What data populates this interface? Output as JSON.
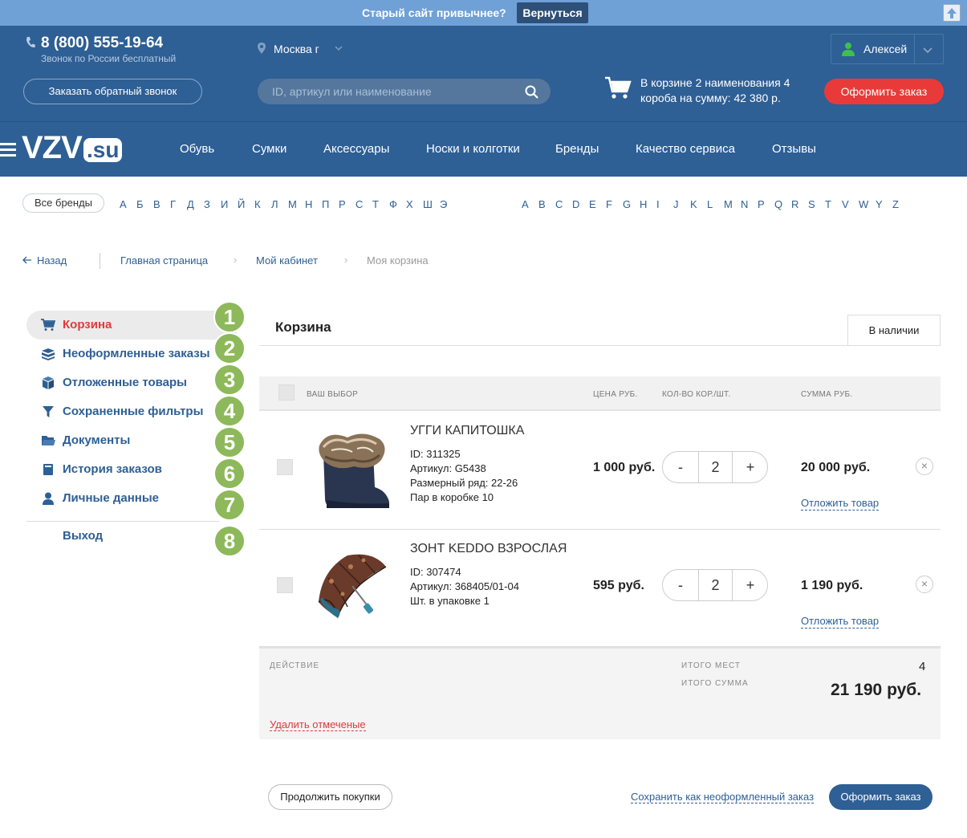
{
  "topbar": {
    "question": "Старый сайт привычнее?",
    "return_label": "Вернуться"
  },
  "header": {
    "phone": "8 (800) 555-19-64",
    "phone_sub": "Звонок по России бесплатный",
    "city": "Москва г",
    "user": "Алексей",
    "callback_label": "Заказать обратный звонок",
    "search_placeholder": "ID, артикул или наименование",
    "cart_text": "В корзине 2 наименования 4 короба на сумму: 42 380 р.",
    "order_label": "Оформить заказ"
  },
  "logo": {
    "text_main": "VZV",
    "text_dot": ".su"
  },
  "nav": [
    "Обувь",
    "Сумки",
    "Аксессуары",
    "Носки и колготки",
    "Бренды",
    "Качество сервиса",
    "Отзывы"
  ],
  "brands": {
    "all_label": "Все бренды",
    "cyr": [
      "А",
      "Б",
      "В",
      "Г",
      "Д",
      "З",
      "И",
      "Й",
      "К",
      "Л",
      "М",
      "Н",
      "П",
      "Р",
      "С",
      "Т",
      "Ф",
      "Х",
      "Ш",
      "Э"
    ],
    "lat": [
      "A",
      "B",
      "C",
      "D",
      "E",
      "F",
      "G",
      "H",
      "I",
      "J",
      "K",
      "L",
      "M",
      "N",
      "P",
      "Q",
      "R",
      "S",
      "T",
      "V",
      "W",
      "Y",
      "Z"
    ]
  },
  "breadcrumb": {
    "back": "Назад",
    "items": [
      "Главная страница",
      "Мой кабинет",
      "Моя корзина"
    ]
  },
  "sidebar": {
    "items": [
      {
        "label": "Корзина",
        "icon": "cart-icon",
        "num": "1"
      },
      {
        "label": "Неоформленные заказы",
        "icon": "boxes-icon",
        "num": "2"
      },
      {
        "label": "Отложенные товары",
        "icon": "box-icon",
        "num": "3"
      },
      {
        "label": "Сохраненные фильтры",
        "icon": "filter-icon",
        "num": "4"
      },
      {
        "label": "Документы",
        "icon": "folder-icon",
        "num": "5"
      },
      {
        "label": "История заказов",
        "icon": "book-icon",
        "num": "6"
      },
      {
        "label": "Личные данные",
        "icon": "user-icon",
        "num": "7"
      }
    ],
    "exit": {
      "label": "Выход",
      "num": "8"
    }
  },
  "cart": {
    "title": "Корзина",
    "tab": "В наличии",
    "columns": {
      "choice": "ВАШ ВЫБОР",
      "price": "ЦЕНА РУБ.",
      "qty": "КОЛ-ВО КОР./ШТ.",
      "sum": "СУММА РУБ."
    },
    "items": [
      {
        "name": "УГГИ КАПИТОШКА",
        "id": "ID: 311325",
        "article": "Артикул: G5438",
        "extra1": "Размерный ряд: 22-26",
        "extra2": "Пар в коробке 10",
        "price": "1 000 руб.",
        "qty": "2",
        "sum": "20 000 руб.",
        "defer": "Отложить товар"
      },
      {
        "name": "ЗОНТ KEDDO ВЗРОСЛАЯ",
        "id": "ID: 307474",
        "article": "Артикул: 368405/01-04",
        "extra1": "Шт. в упаковке 1",
        "price": "595 руб.",
        "qty": "2",
        "sum": "1 190 руб.",
        "defer": "Отложить товар"
      }
    ],
    "minus": "-",
    "plus": "+",
    "remove": "×",
    "footer": {
      "action_label": "ДЕЙСТВИЕ",
      "delete_marked": "Удалить отмеченые",
      "total_places_label": "ИТОГО МЕСТ",
      "total_places": "4",
      "total_sum_label": "ИТОГО СУММА",
      "total_sum": "21 190 руб."
    },
    "continue_label": "Продолжить покупки",
    "save_label": "Сохранить как неоформленный заказ",
    "order_label": "Оформить заказ"
  },
  "colors": {
    "header": "#2e5f95",
    "topbar": "#6fa0d6",
    "accent_red": "#e93a3a",
    "badge_green": "#8db95a"
  }
}
